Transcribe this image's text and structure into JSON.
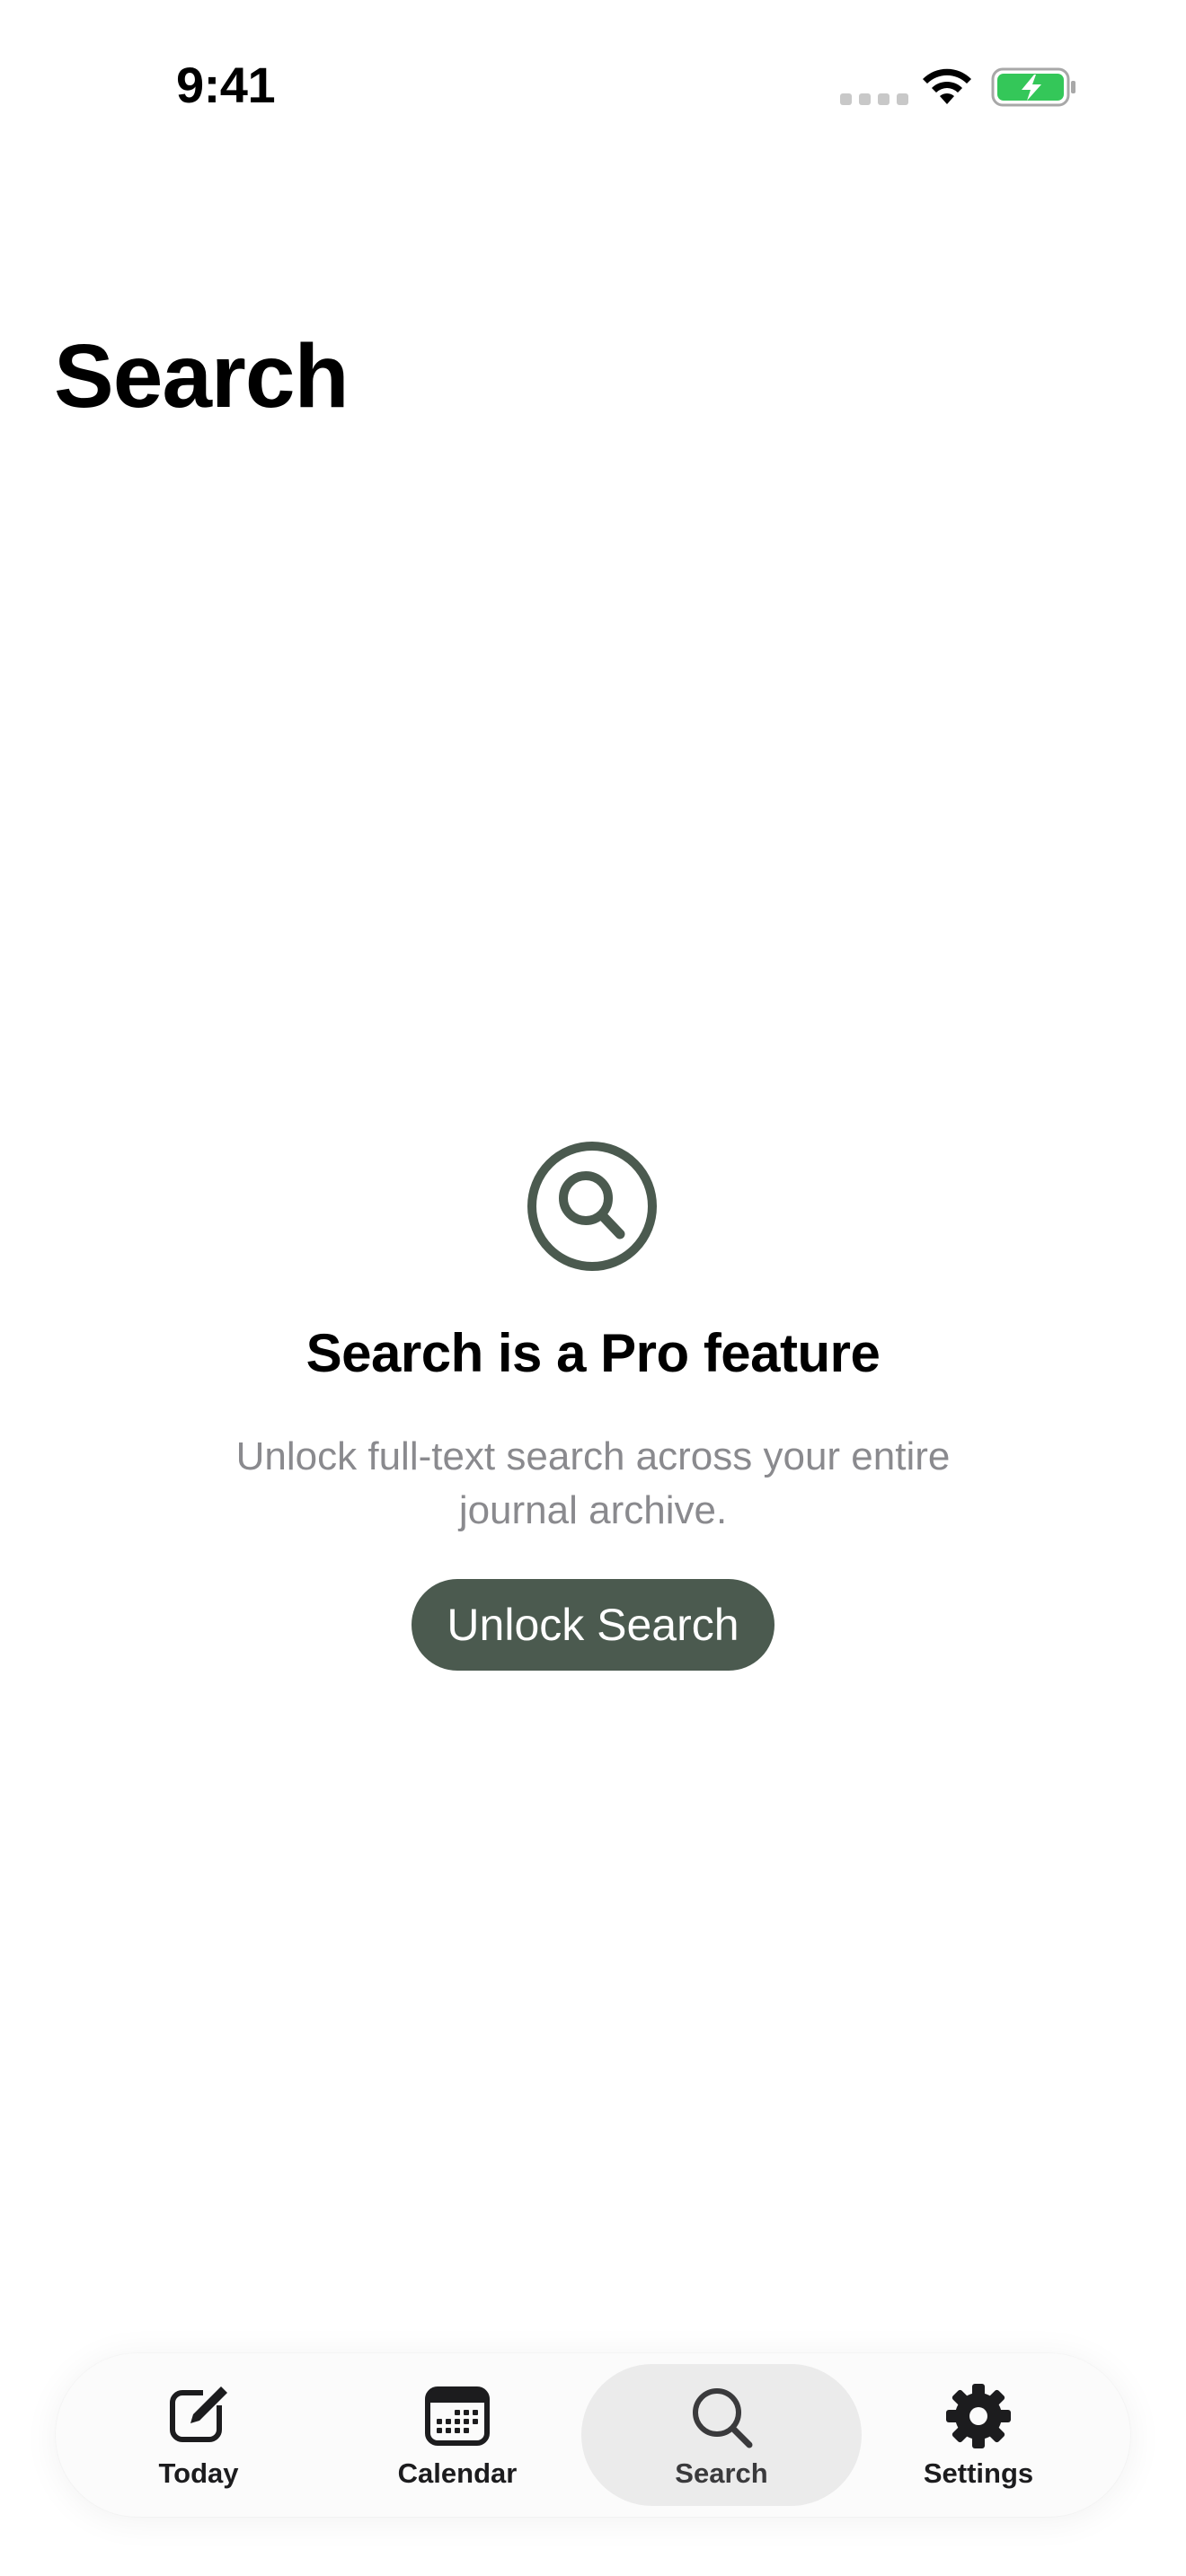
{
  "status_bar": {
    "time": "9:41"
  },
  "header": {
    "title": "Search"
  },
  "empty_state": {
    "icon": "magnifying-glass-circle-icon",
    "heading": "Search is a Pro feature",
    "description": "Unlock full-text search across your entire journal archive.",
    "button_label": "Unlock Search"
  },
  "tabbar": {
    "items": [
      {
        "label": "Today",
        "icon": "compose-icon"
      },
      {
        "label": "Calendar",
        "icon": "calendar-icon"
      },
      {
        "label": "Search",
        "icon": "search-icon",
        "selected": true
      },
      {
        "label": "Settings",
        "icon": "gear-icon"
      }
    ]
  },
  "colors": {
    "accent": "#4b5a4f",
    "battery_green": "#34c759",
    "secondary_text": "#8a8a8e",
    "selected_tab_bg": "#ebebeb"
  }
}
